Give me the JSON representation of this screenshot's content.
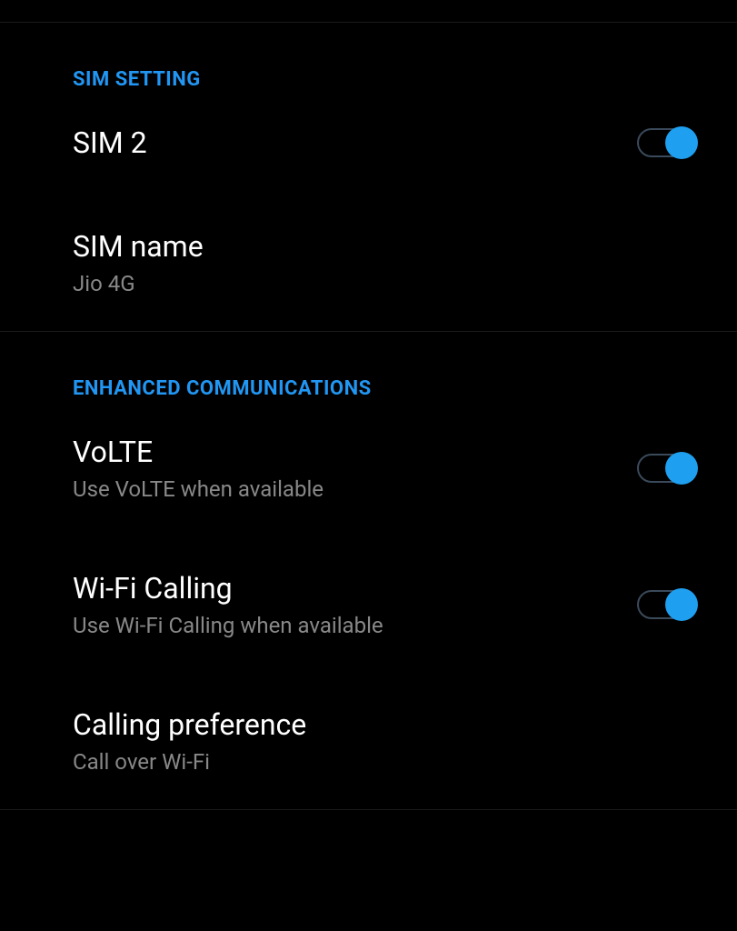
{
  "sections": [
    {
      "header": "SIM SETTING",
      "items": [
        {
          "title": "SIM 2",
          "subtitle": null,
          "toggle": true
        },
        {
          "title": "SIM name",
          "subtitle": "Jio 4G",
          "toggle": null
        }
      ]
    },
    {
      "header": "ENHANCED COMMUNICATIONS",
      "items": [
        {
          "title": "VoLTE",
          "subtitle": "Use VoLTE when available",
          "toggle": true
        },
        {
          "title": "Wi-Fi Calling",
          "subtitle": "Use Wi-Fi Calling when available",
          "toggle": true
        },
        {
          "title": "Calling preference",
          "subtitle": "Call over Wi-Fi",
          "toggle": null
        }
      ]
    }
  ]
}
